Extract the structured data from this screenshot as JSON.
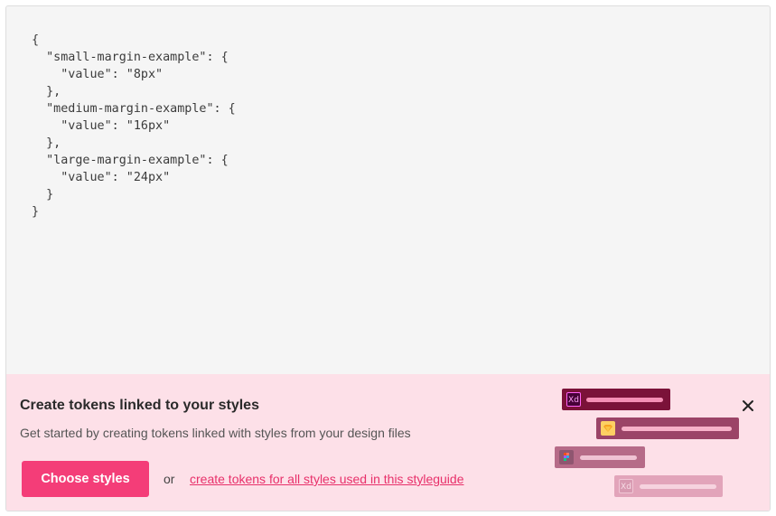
{
  "code_block": {
    "text": "{\n  \"small-margin-example\": {\n    \"value\": \"8px\"\n  },\n  \"medium-margin-example\": {\n    \"value\": \"16px\"\n  },\n  \"large-margin-example\": {\n    \"value\": \"24px\"\n  }\n}"
  },
  "banner": {
    "title": "Create tokens linked to your styles",
    "description": "Get started by creating tokens linked with styles from your design files",
    "choose_button": "Choose styles",
    "or_text": "or",
    "create_all_link": "create tokens for all styles used in this styleguide",
    "close_icon": "close-icon"
  },
  "illustration": {
    "tokens": [
      {
        "icon": "adobe-xd-icon",
        "icon_text": "Xd",
        "color": "#7b1239"
      },
      {
        "icon": "sketch-icon",
        "icon_text": "",
        "color": "#9b4467"
      },
      {
        "icon": "figma-icon",
        "icon_text": "",
        "color": "#b66b88"
      },
      {
        "icon": "adobe-xd-icon",
        "icon_text": "Xd",
        "color": "#e2a4ba"
      }
    ]
  },
  "colors": {
    "accent": "#f43d78",
    "banner_bg": "#fde0e8",
    "code_bg": "#f5f5f5"
  }
}
